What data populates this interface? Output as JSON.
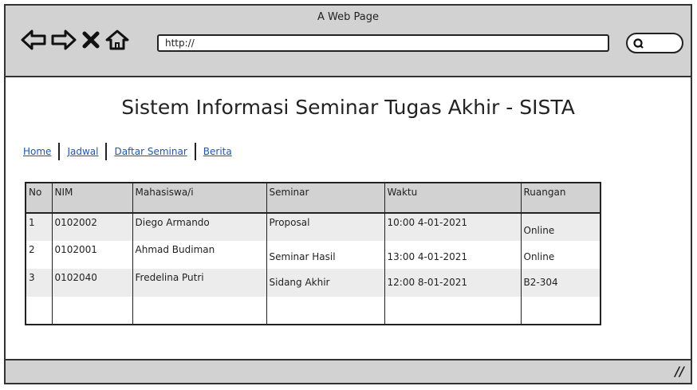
{
  "window": {
    "title": "A Web Page"
  },
  "browser": {
    "url": "http://"
  },
  "page": {
    "title": "Sistem Informasi Seminar Tugas Akhir - SISTA"
  },
  "nav": {
    "links": [
      "Home",
      "Jadwal",
      "Daftar Seminar",
      "Berita"
    ]
  },
  "table": {
    "headers": [
      "No",
      "NIM",
      "Mahasiswa/i",
      "Seminar",
      "Waktu",
      "Ruangan"
    ],
    "rows": [
      [
        "1",
        "0102002",
        "Diego Armando",
        "Proposal",
        "10:00 4-01-2021",
        "Online"
      ],
      [
        "2",
        "0102001",
        "Ahmad Budiman",
        "Seminar Hasil",
        "13:00 4-01-2021",
        "Online"
      ],
      [
        "3",
        "0102040",
        "Fredelina Putri",
        "Sidang Akhir",
        "12:00 8-01-2021",
        "B2-304"
      ],
      [
        "",
        "",
        "",
        "",
        "",
        ""
      ]
    ]
  },
  "icons": [
    "back-icon",
    "forward-icon",
    "close-icon",
    "home-icon",
    "search-icon",
    "resize-grip-icon"
  ],
  "colors": {
    "chrome": "#d2d2d2",
    "link": "#1c57b5",
    "row_alt": "#ececec",
    "border": "#222222"
  }
}
